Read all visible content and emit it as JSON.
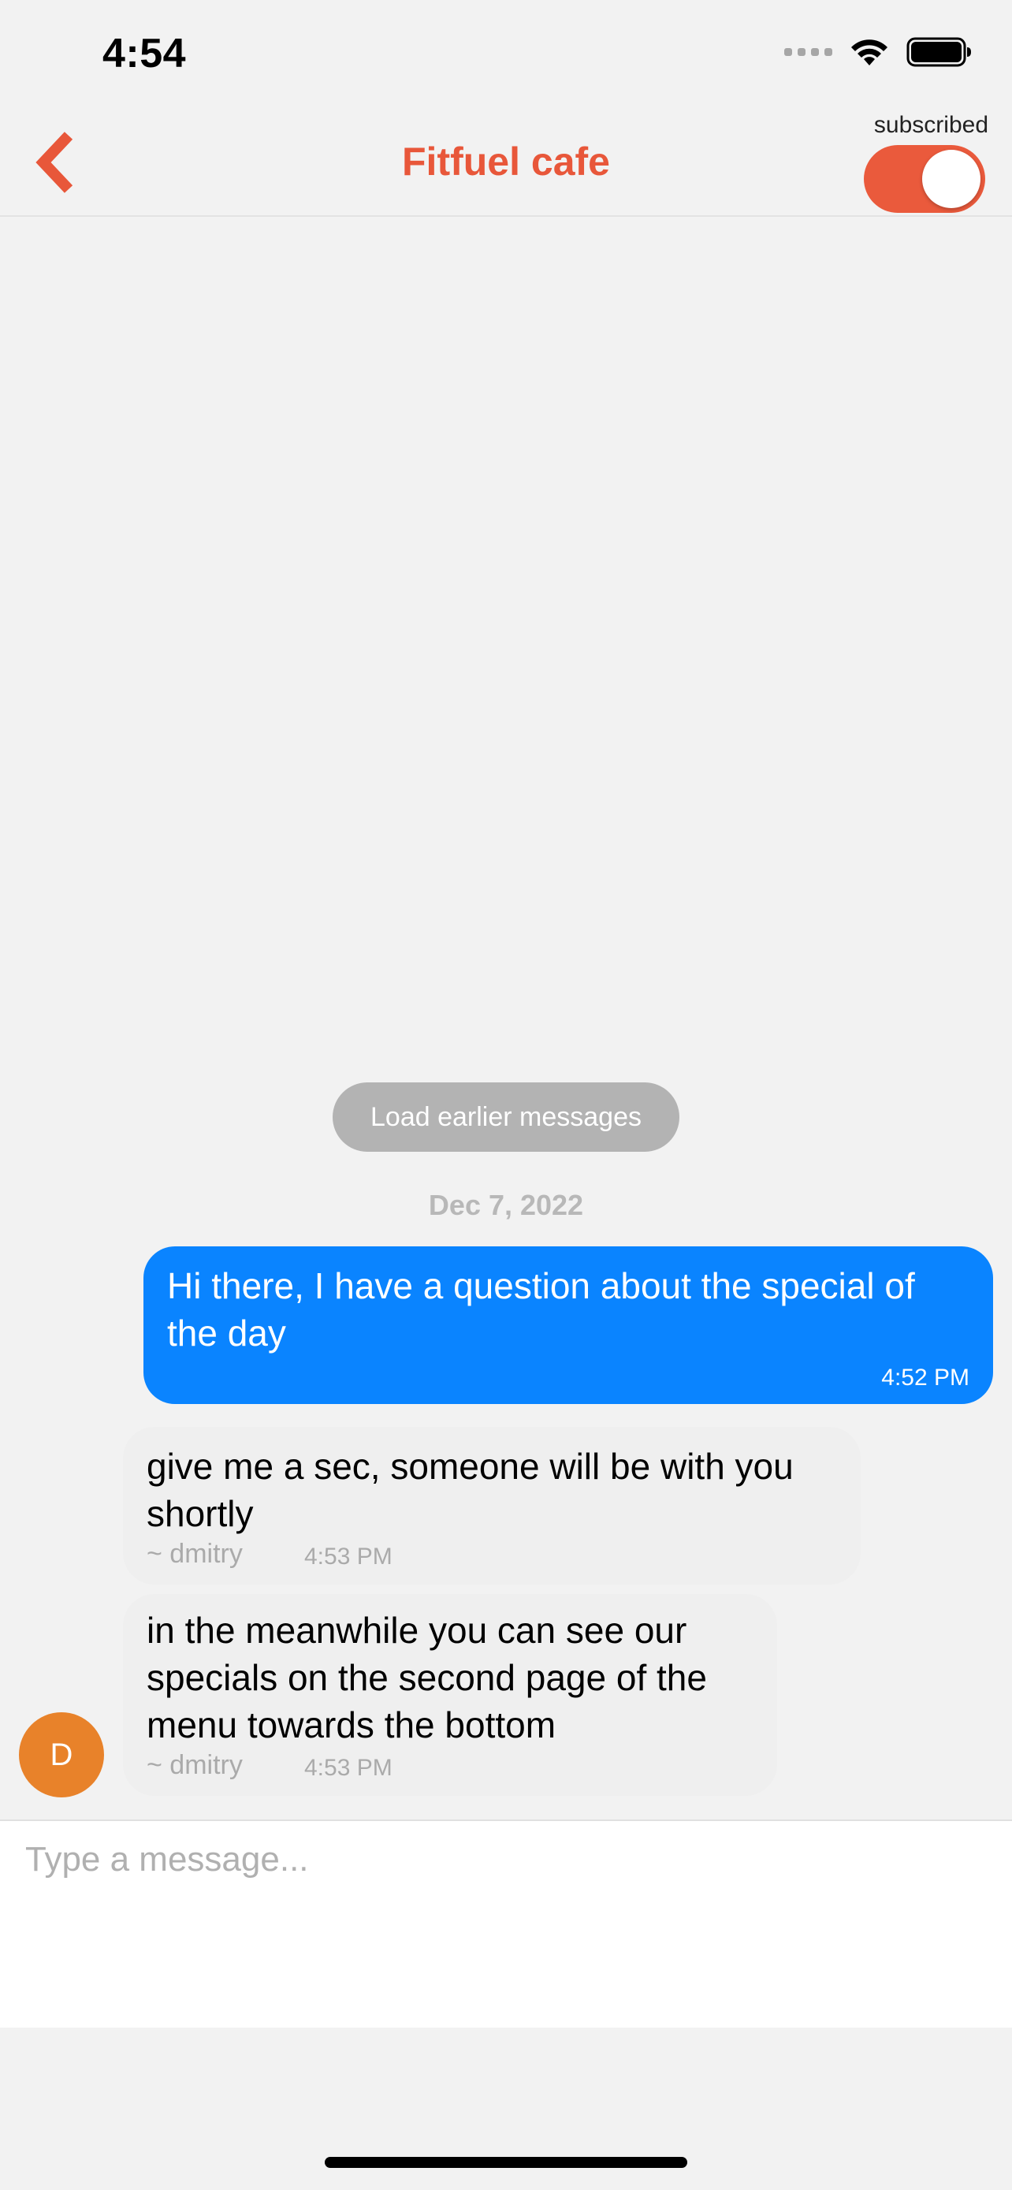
{
  "status_bar": {
    "time": "4:54",
    "icons": [
      "signal-dots-icon",
      "wifi-icon",
      "battery-icon"
    ]
  },
  "header": {
    "title": "Fitfuel cafe",
    "back_icon": "chevron-left-icon",
    "subscribed_label": "subscribed",
    "subscribed_on": true
  },
  "chat": {
    "load_earlier_label": "Load earlier messages",
    "date_separator": "Dec 7, 2022",
    "messages": [
      {
        "direction": "outgoing",
        "text": "Hi there, I have a question about the special of the day",
        "time": "4:52 PM"
      },
      {
        "direction": "incoming",
        "text": "give me a sec, someone will be with you shortly",
        "author": "~ dmitry",
        "time": "4:53 PM"
      },
      {
        "direction": "incoming",
        "text": "in the meanwhile you can see our specials on the second page of the menu towards the bottom",
        "author": "~ dmitry",
        "time": "4:53 PM"
      }
    ],
    "avatar_initial": "D"
  },
  "composer": {
    "placeholder": "Type a message..."
  },
  "colors": {
    "accent": "#e8573a",
    "outgoing_bubble": "#0a84ff",
    "incoming_bubble": "#efefef",
    "avatar": "#e8822a",
    "background": "#f2f2f2"
  }
}
